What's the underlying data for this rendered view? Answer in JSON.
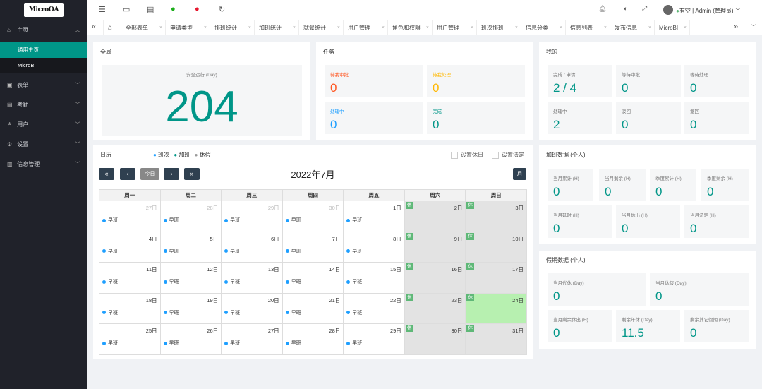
{
  "app": {
    "logo": "MicroOA"
  },
  "sidebar": {
    "items": [
      {
        "label": "主页",
        "icon": "home-icon"
      },
      {
        "label": "表单",
        "icon": "form-icon"
      },
      {
        "label": "考勤",
        "icon": "attendance-icon"
      },
      {
        "label": "用户",
        "icon": "user-icon"
      },
      {
        "label": "设置",
        "icon": "gear-icon"
      },
      {
        "label": "信息管理",
        "icon": "info-icon"
      }
    ],
    "sub": [
      {
        "label": "通用主页"
      },
      {
        "label": "MicroBI"
      }
    ]
  },
  "topbar": {
    "user": "有空 | Admin (管理员)"
  },
  "tabs": [
    {
      "label": "全部表单"
    },
    {
      "label": "申请类型"
    },
    {
      "label": "排班统计"
    },
    {
      "label": "加班统计"
    },
    {
      "label": "就餐统计"
    },
    {
      "label": "用户管理"
    },
    {
      "label": "角色和权限"
    },
    {
      "label": "用户管理"
    },
    {
      "label": "班次排班"
    },
    {
      "label": "信息分类"
    },
    {
      "label": "信息列表"
    },
    {
      "label": "发布信息"
    },
    {
      "label": "MicroBI"
    }
  ],
  "global": {
    "title": "全局",
    "label": "安全运行 (Day)",
    "value": "204"
  },
  "tasks": {
    "title": "任务",
    "items": [
      {
        "label": "待我审批",
        "value": "0"
      },
      {
        "label": "待我处理",
        "value": "0"
      },
      {
        "label": "处理中",
        "value": "0"
      },
      {
        "label": "完成",
        "value": "0"
      }
    ],
    "colors": {
      "pending": "#ff5722",
      "handle": "#ffb800",
      "processing": "#1e9fff",
      "done": "#009688"
    }
  },
  "mine": {
    "title": "我的",
    "items": [
      {
        "label": "完成 / 申请",
        "value": "2 / 4"
      },
      {
        "label": "等待审批",
        "value": "0"
      },
      {
        "label": "等待处理",
        "value": "0"
      },
      {
        "label": "处理中",
        "value": "2"
      },
      {
        "label": "驳回",
        "value": "0"
      },
      {
        "label": "撤回",
        "value": "0"
      }
    ]
  },
  "calendar": {
    "title": "日历",
    "legend": [
      {
        "label": "班次",
        "color": "#1e9fff"
      },
      {
        "label": "加班",
        "color": "#009688"
      },
      {
        "label": "休假",
        "color": "#999999"
      }
    ],
    "set_rest": "设置休日",
    "set_holiday": "设置法定",
    "today_btn": "今日",
    "month_title": "2022年7月",
    "view_btn": "月",
    "weekdays": [
      "周一",
      "周二",
      "周三",
      "周四",
      "周五",
      "周六",
      "周日"
    ],
    "event_label": "早班",
    "rest_label": "休",
    "weeks": [
      [
        "27日",
        "28日",
        "29日",
        "30日",
        "1日",
        "2日",
        "3日"
      ],
      [
        "4日",
        "5日",
        "6日",
        "7日",
        "8日",
        "9日",
        "10日"
      ],
      [
        "11日",
        "12日",
        "13日",
        "14日",
        "15日",
        "16日",
        "17日"
      ],
      [
        "18日",
        "19日",
        "20日",
        "21日",
        "22日",
        "23日",
        "24日"
      ],
      [
        "25日",
        "26日",
        "27日",
        "28日",
        "29日",
        "30日",
        "31日"
      ]
    ]
  },
  "overtime": {
    "title": "加班数据 (个人)",
    "items": [
      {
        "label": "当月累计 (H)",
        "value": "0"
      },
      {
        "label": "当月剩余 (H)",
        "value": "0"
      },
      {
        "label": "季度累计 (H)",
        "value": "0"
      },
      {
        "label": "季度剩余 (H)",
        "value": "0"
      },
      {
        "label": "当月延时 (H)",
        "value": "0"
      },
      {
        "label": "当月休出 (H)",
        "value": "0"
      },
      {
        "label": "当月法定 (H)",
        "value": "0"
      }
    ]
  },
  "vacation": {
    "title": "假期数据 (个人)",
    "items": [
      {
        "label": "当月代休 (Day)",
        "value": "0"
      },
      {
        "label": "当月休假 (Day)",
        "value": "0"
      },
      {
        "label": "当月剩余休出 (H)",
        "value": "0"
      },
      {
        "label": "剩余年休 (Day)",
        "value": "11.5"
      },
      {
        "label": "剩余其它假期 (Day)",
        "value": "0"
      }
    ]
  },
  "colors": {
    "accent": "#009688",
    "sidebar": "#20222a",
    "today": "#b7f0b0",
    "rest_badge": "#5fb878"
  }
}
